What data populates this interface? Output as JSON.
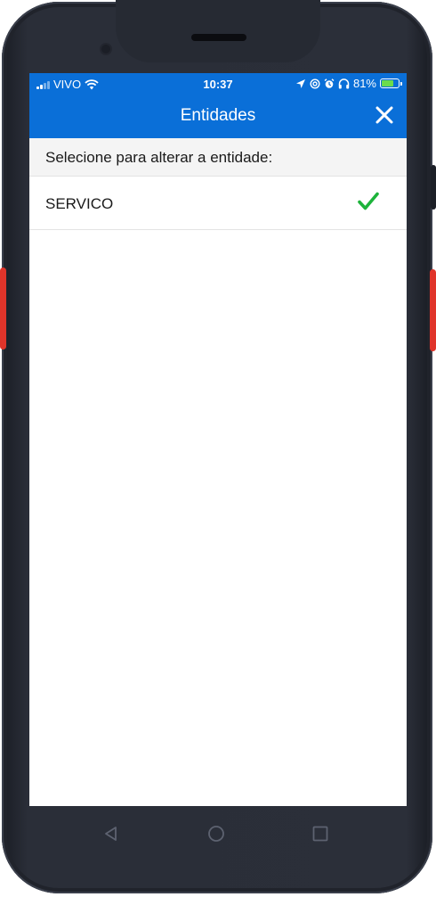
{
  "status_bar": {
    "carrier": "VIVO",
    "time": "10:37",
    "battery_percent": "81%",
    "battery_level": 0.81,
    "icons": [
      "signal-icon",
      "wifi-icon",
      "location-icon",
      "at-icon",
      "alarm-icon",
      "headphones-icon",
      "battery-icon"
    ]
  },
  "header": {
    "title": "Entidades",
    "close_icon": "close-icon"
  },
  "section": {
    "prompt": "Selecione para alterar a entidade:"
  },
  "entities": [
    {
      "label": "SERVICO",
      "selected": true
    }
  ],
  "colors": {
    "accent": "#0a6fd8",
    "check": "#1db33b"
  },
  "system_nav": {
    "icons": [
      "back-icon",
      "home-icon",
      "recents-icon"
    ]
  }
}
